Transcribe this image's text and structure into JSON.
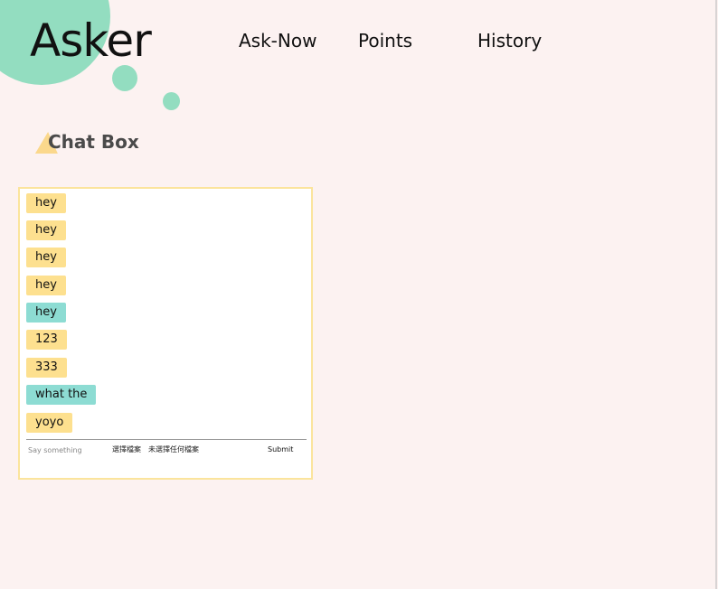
{
  "header": {
    "logo": "Asker",
    "nav": [
      "Ask-Now",
      "Points",
      "History"
    ]
  },
  "section": {
    "title": "Chat Box"
  },
  "chat": {
    "messages": [
      {
        "text": "hey",
        "color": "yellow"
      },
      {
        "text": "hey",
        "color": "yellow"
      },
      {
        "text": "hey",
        "color": "yellow"
      },
      {
        "text": "hey",
        "color": "yellow"
      },
      {
        "text": "hey",
        "color": "teal"
      },
      {
        "text": "123",
        "color": "yellow"
      },
      {
        "text": "333",
        "color": "yellow"
      },
      {
        "text": "what the",
        "color": "teal"
      },
      {
        "text": "yoyo",
        "color": "yellow"
      }
    ],
    "input_placeholder": "Say something",
    "file_button_label": "選擇檔案",
    "file_status": "未選擇任何檔案",
    "submit_label": "Submit"
  },
  "colors": {
    "background": "#fcf2f1",
    "accent_green": "#93ddc0",
    "bubble_yellow": "#fde08f",
    "bubble_teal": "#8ddcd3",
    "box_border": "#fbe49c"
  }
}
